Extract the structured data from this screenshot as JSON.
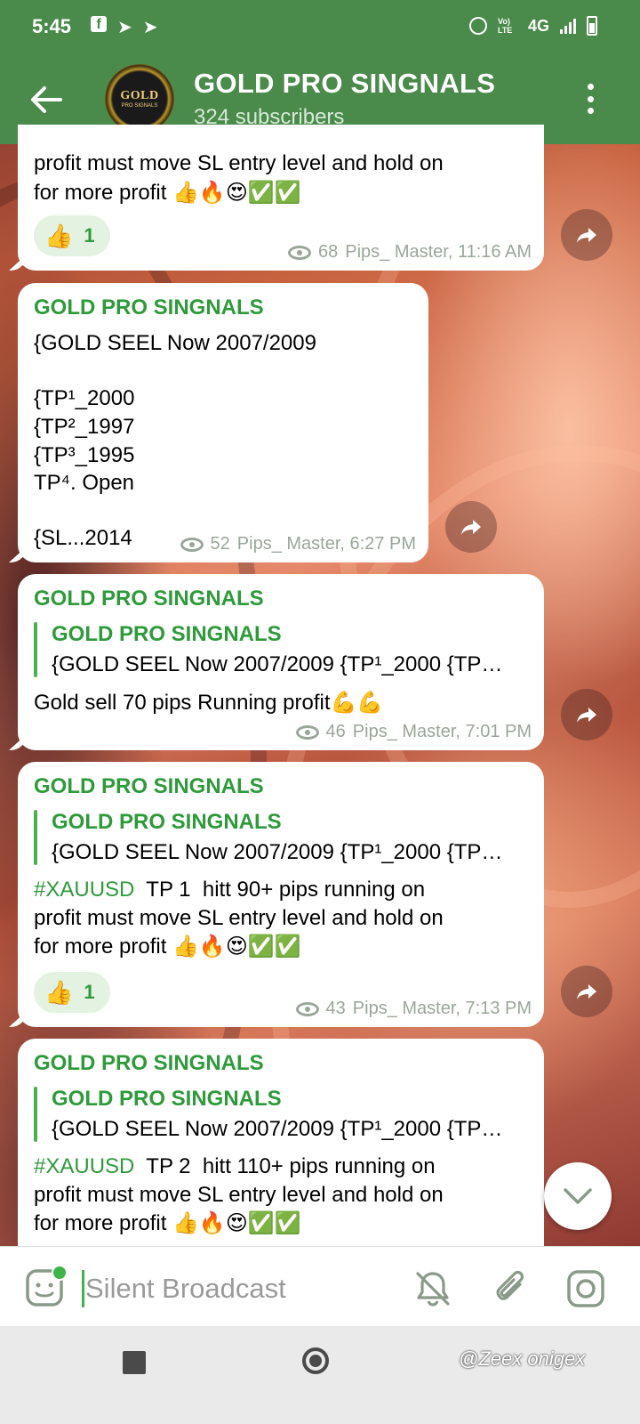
{
  "status_bar": {
    "time": "5:45",
    "network": "4G",
    "volte": "Vo) LTE"
  },
  "app_bar": {
    "title": "GOLD PRO SINGNALS",
    "subtitle": "324 subscribers",
    "avatar_logo": "GOLD",
    "avatar_logo_sub": "PRO SIGNALS"
  },
  "messages": [
    {
      "lines": [
        "profit must move SL entry level and hold on",
        "for more profit 👍🔥😍✅✅"
      ],
      "reaction": {
        "emoji": "👍",
        "count": "1"
      },
      "views": "68",
      "author_time": "Pips_ Master, 11:16 AM"
    },
    {
      "sender": "GOLD PRO SINGNALS",
      "lines": [
        "{GOLD SEEL Now 2007/2009",
        "",
        "{TP¹_2000",
        "{TP²_1997",
        "{TP³_1995",
        "TP⁴.  Open",
        "",
        "{SL...2014"
      ],
      "views": "52",
      "author_time": "Pips_ Master, 6:27 PM"
    },
    {
      "sender": "GOLD PRO SINGNALS",
      "quote_title": "GOLD PRO SINGNALS",
      "quote_text": "{GOLD SEEL Now 2007/2009  {TP¹_2000 {TP…",
      "lines": [
        "Gold sell 70 pips Running profit💪💪"
      ],
      "views": "46",
      "author_time": "Pips_ Master, 7:01 PM"
    },
    {
      "sender": "GOLD PRO SINGNALS",
      "quote_title": "GOLD PRO SINGNALS",
      "quote_text": "{GOLD SEEL Now 2007/2009  {TP¹_2000 {TP…",
      "hashtag": "#XAUUSD",
      "first_line_rest": "  TP 1  hitt 90+ pips running on",
      "lines": [
        "profit must move SL entry level and hold on",
        "for more profit 👍🔥😍✅✅"
      ],
      "reaction": {
        "emoji": "👍",
        "count": "1"
      },
      "views": "43",
      "author_time": "Pips_ Master, 7:13 PM"
    },
    {
      "sender": "GOLD PRO SINGNALS",
      "quote_title": "GOLD PRO SINGNALS",
      "quote_text": "{GOLD SEEL Now 2007/2009  {TP¹_2000 {TP…",
      "hashtag": "#XAUUSD",
      "first_line_rest": "  TP 2  hitt 110+ pips running on",
      "lines": [
        "profit must move SL entry level and hold on",
        "for more profit 👍🔥😍✅✅"
      ]
    }
  ],
  "input": {
    "placeholder": "Silent Broadcast"
  },
  "watermark": "@Zeex onigex",
  "colors": {
    "header_green": "#4a8a4a",
    "sender_green": "#2e9a3a",
    "bubble_bg": "#ffffff",
    "meta_gray": "#9aa69a"
  }
}
